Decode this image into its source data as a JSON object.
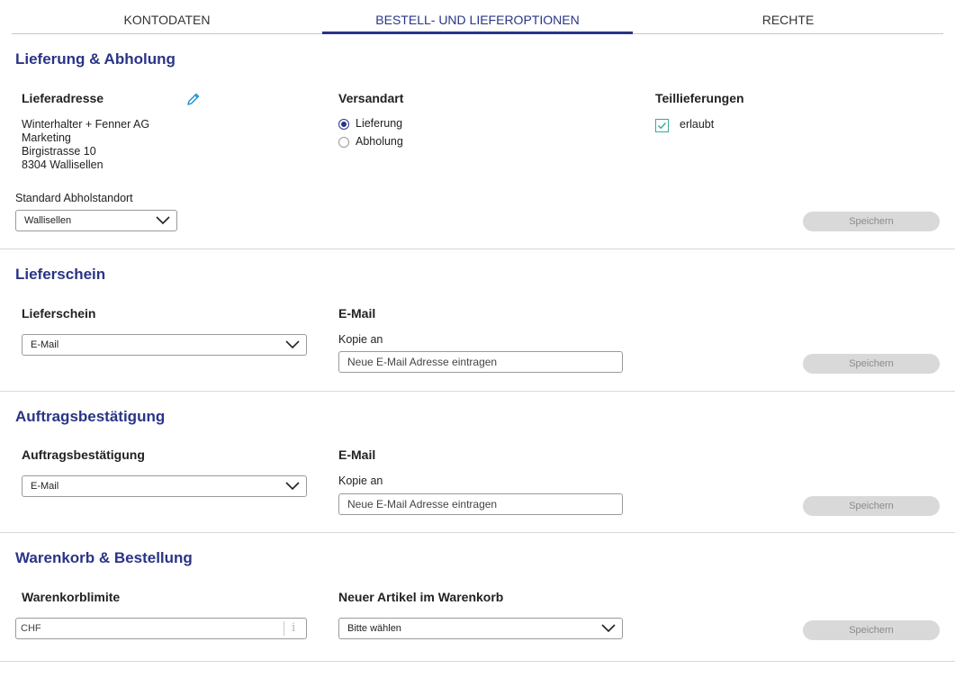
{
  "tabs": [
    {
      "label": "KONTODATEN",
      "active": false
    },
    {
      "label": "BESTELL- UND LIEFEROPTIONEN",
      "active": true
    },
    {
      "label": "RECHTE",
      "active": false
    }
  ],
  "lieferung": {
    "title": "Lieferung & Abholung",
    "address_label": "Lieferadresse",
    "address_lines": [
      "Winterhalter + Fenner AG",
      "Marketing",
      "Birgistrasse 10",
      "8304 Wallisellen"
    ],
    "versandart_label": "Versandart",
    "versandart_options": [
      {
        "label": "Lieferung",
        "checked": true
      },
      {
        "label": "Abholung",
        "checked": false
      }
    ],
    "teillieferungen_label": "Teillieferungen",
    "teillieferungen_checkbox_label": "erlaubt",
    "teillieferungen_checked": true,
    "standort_label": "Standard Abholstandort",
    "standort_value": "Wallisellen",
    "save_label": "Speichern"
  },
  "lieferschein": {
    "title": "Lieferschein",
    "select_label": "Lieferschein",
    "select_value": "E-Mail",
    "email_label": "E-Mail",
    "copy_label": "Kopie an",
    "email_placeholder": "Neue E-Mail Adresse eintragen",
    "save_label": "Speichern"
  },
  "auftrag": {
    "title": "Auftragsbestätigung",
    "select_label": "Auftragsbestätigung",
    "select_value": "E-Mail",
    "email_label": "E-Mail",
    "copy_label": "Kopie an",
    "email_placeholder": "Neue E-Mail Adresse eintragen",
    "save_label": "Speichern"
  },
  "warenkorb": {
    "title": "Warenkorb & Bestellung",
    "limit_label": "Warenkorblimite",
    "limit_currency": "CHF",
    "info_glyph": "i",
    "new_item_label": "Neuer Artikel im Warenkorb",
    "new_item_value": "Bitte wählen",
    "save_label": "Speichern"
  },
  "colors": {
    "accent": "#2a3486",
    "edit_icon": "#1a8fd1",
    "checkbox": "#3aa89a",
    "button_disabled_bg": "#d9d9d9"
  },
  "icons": [
    "pencil-icon",
    "chevron-down-icon",
    "checkmark-icon",
    "info-icon"
  ]
}
